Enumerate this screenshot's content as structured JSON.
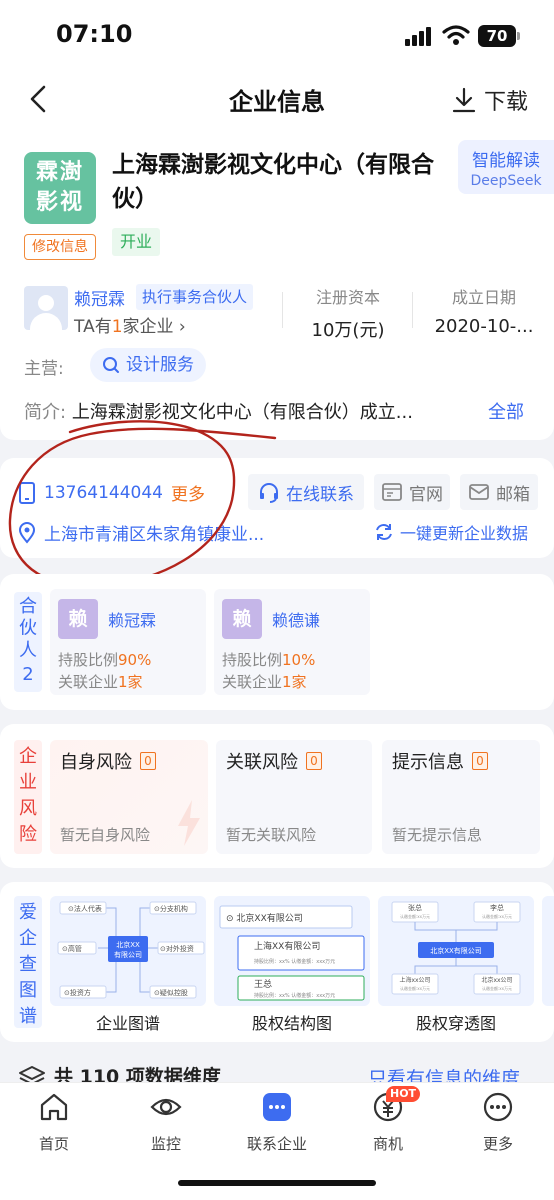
{
  "status_bar": {
    "time": "07:10",
    "battery": "70"
  },
  "nav": {
    "title": "企业信息",
    "download": "下载"
  },
  "company": {
    "logo_line1": "霖澍",
    "logo_line2": "影视",
    "name": "上海霖澍影视文化中心（有限合伙）",
    "ai_line1": "智能解读",
    "ai_line2": "DeepSeek",
    "edit": "修改信息",
    "status": "开业",
    "person": "赖冠霖",
    "role": "执行事务合伙人",
    "ta_prefix": "TA有",
    "ta_count": "1",
    "ta_suffix": "家企业 ›",
    "capital_label": "注册资本",
    "capital_value": "10万(元)",
    "date_label": "成立日期",
    "date_value": "2020-10-...",
    "main_label": "主营:",
    "service": "设计服务",
    "brief_label": "简介:",
    "brief_text": "上海霖澍影视文化中心（有限合伙）成立...",
    "all": "全部"
  },
  "contact": {
    "phone": "13764144044",
    "more": "更多",
    "online": "在线联系",
    "website": "官网",
    "email": "邮箱",
    "address": "上海市青浦区朱家角镇康业...",
    "update": "一键更新企业数据"
  },
  "partners": {
    "label": "合伙人",
    "count": "2",
    "items": [
      {
        "avatar": "赖",
        "name": "赖冠霖",
        "ratio_label": "持股比例",
        "ratio": "90%",
        "related_label": "关联企业",
        "related": "1家"
      },
      {
        "avatar": "赖",
        "name": "赖德谦",
        "ratio_label": "持股比例",
        "ratio": "10%",
        "related_label": "关联企业",
        "related": "1家"
      }
    ]
  },
  "risk": {
    "label": "企业风险",
    "items": [
      {
        "title": "自身风险",
        "count": "0",
        "none": "暂无自身风险"
      },
      {
        "title": "关联风险",
        "count": "0",
        "none": "暂无关联风险"
      },
      {
        "title": "提示信息",
        "count": "0",
        "none": "暂无提示信息"
      }
    ]
  },
  "graph": {
    "label": "爱企查图谱",
    "items": [
      {
        "caption": "企业图谱",
        "center": "北京XX有限公司",
        "nodes": [
          "法人代表",
          "分支机构",
          "高管",
          "对外投资",
          "投资方",
          "疑似控股"
        ]
      },
      {
        "caption": "股权结构图",
        "c1": "北京XX有限公司",
        "c2": "上海XX有限公司",
        "c3": "王总",
        "hold": "持股比例：xx%",
        "amt": "认缴金额：xxx万元"
      },
      {
        "caption": "股权穿透图",
        "p1": "张总",
        "p2": "李总",
        "center": "北京XX有限公司",
        "s1": "上海xx公司",
        "s2": "北京xx公司"
      }
    ]
  },
  "dims": {
    "text": "共 110 项数据维度",
    "only": "只看有信息的维度"
  },
  "tabs": [
    {
      "label": "首页"
    },
    {
      "label": "监控"
    },
    {
      "label": "联系企业"
    },
    {
      "label": "商机",
      "badge": "HOT"
    },
    {
      "label": "更多"
    }
  ],
  "colors": {
    "accent": "#3d6cf0",
    "orange": "#f07320",
    "green": "#2fae5b",
    "red": "#e8403a",
    "annotation": "#b3241c"
  }
}
